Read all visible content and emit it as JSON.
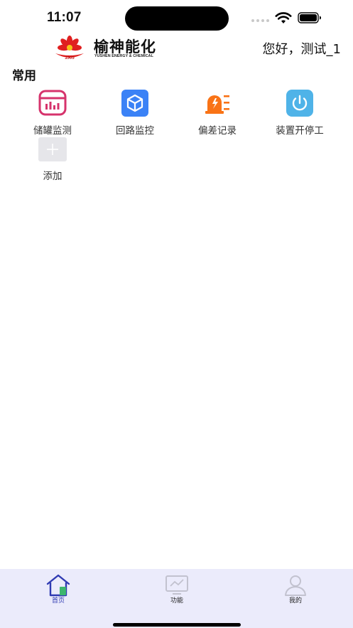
{
  "status_bar": {
    "time": "11:07"
  },
  "header": {
    "logo_mark_text": "1905",
    "logo_cn": "榆神能化",
    "logo_en": "YUSHEN ENERGY & CHEMICAL",
    "greeting": "您好，测试_1"
  },
  "section_title": "常用",
  "grid": [
    {
      "label": "储罐监测",
      "icon": "tank-monitor-icon",
      "color": "#d6336c"
    },
    {
      "label": "回路监控",
      "icon": "cube-icon",
      "color": "#3b82f6"
    },
    {
      "label": "偏差记录",
      "icon": "alarm-light-icon",
      "color": "#f97316"
    },
    {
      "label": "装置开停工",
      "icon": "power-icon",
      "color": "#4fb3e8"
    },
    {
      "label": "添加",
      "icon": "add-icon",
      "color": "#e6e6ea"
    }
  ],
  "tab_bar": {
    "active_color": "#2f3ab2",
    "tabs": [
      {
        "label": "首页",
        "icon": "home-icon",
        "active": true
      },
      {
        "label": "功能",
        "icon": "monitor-chart-icon",
        "active": false
      },
      {
        "label": "我的",
        "icon": "user-icon",
        "active": false
      }
    ]
  }
}
